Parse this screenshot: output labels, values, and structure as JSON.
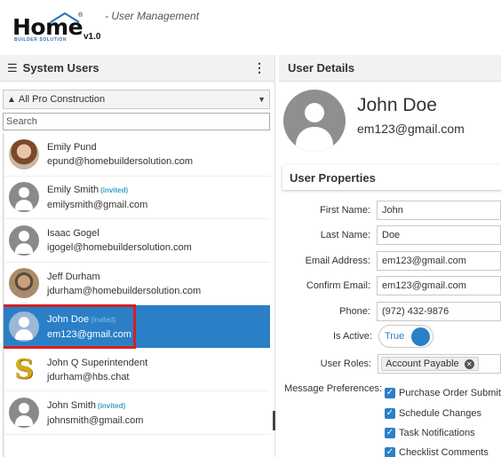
{
  "app": {
    "logo_text": "Home",
    "logo_sub": "BUILDER SOLUTION",
    "logo_version": "v1.0",
    "subtitle": "- User Management"
  },
  "left": {
    "title": "System Users",
    "company": "All Pro Construction",
    "search_placeholder": "Search",
    "users": [
      {
        "name": "Emily Pund",
        "invited": "",
        "email": "epund@homebuildersolution.com"
      },
      {
        "name": "Emily Smith",
        "invited": "(invited)",
        "email": "emilysmith@gmail.com"
      },
      {
        "name": "Isaac Gogel",
        "invited": "",
        "email": "igogel@homebuildersolution.com"
      },
      {
        "name": "Jeff Durham",
        "invited": "",
        "email": "jdurham@homebuildersolution.com"
      },
      {
        "name": "John Doe",
        "invited": "(invited)",
        "email": "em123@gmail.com"
      },
      {
        "name": "John Q Superintendent",
        "invited": "",
        "email": "jdurham@hbs.chat"
      },
      {
        "name": "John Smith",
        "invited": "(invited)",
        "email": "johnsmith@gmail.com"
      }
    ]
  },
  "right": {
    "title": "User Details",
    "name": "John Doe",
    "email": "em123@gmail.com",
    "props_title": "User Properties",
    "fields": {
      "first_name_label": "First Name:",
      "first_name": "John",
      "last_name_label": "Last Name:",
      "last_name": "Doe",
      "email_label": "Email Address:",
      "email": "em123@gmail.com",
      "confirm_label": "Confirm Email:",
      "confirm": "em123@gmail.com",
      "phone_label": "Phone:",
      "phone": "(972) 432-9876",
      "active_label": "Is Active:",
      "active": "True",
      "roles_label": "User Roles:",
      "role": "Account Payable",
      "msg_label": "Message Preferences:"
    },
    "preferences": [
      "Purchase Order Submitt",
      "Schedule Changes",
      "Task Notifications",
      "Checklist Comments"
    ]
  },
  "colors": {
    "accent": "#2b7fc6",
    "highlight": "#d62020",
    "invited": "#3aa0c8"
  }
}
